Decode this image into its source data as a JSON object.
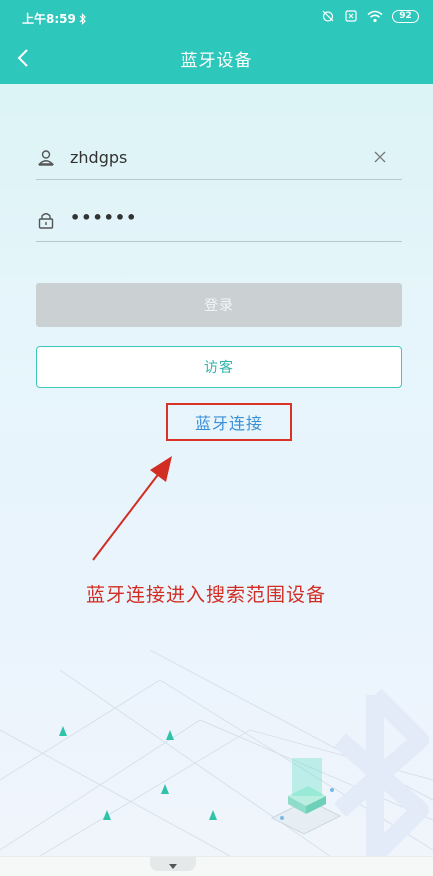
{
  "status_bar": {
    "time": "上午8:59",
    "battery": "92",
    "icons": [
      "bluetooth-icon",
      "alarm-off-icon",
      "sim-icon",
      "wifi-icon",
      "battery-icon"
    ]
  },
  "nav": {
    "title": "蓝牙设备",
    "back_icon": "chevron-left-icon"
  },
  "login_form": {
    "username": "zhdgps",
    "password_mask": "••••••",
    "username_icon": "user-icon",
    "password_icon": "lock-icon",
    "clear_icon": "close-icon"
  },
  "buttons": {
    "login": "登录",
    "guest": "访客",
    "bluetooth_connect": "蓝牙连接"
  },
  "annotation": {
    "text": "蓝牙连接进入搜索范围设备",
    "color": "#d12d22"
  },
  "colors": {
    "header": "#2dc7bb",
    "accent": "#2fb3ab",
    "link": "#3a8fd6",
    "highlight_box": "#d93227"
  }
}
